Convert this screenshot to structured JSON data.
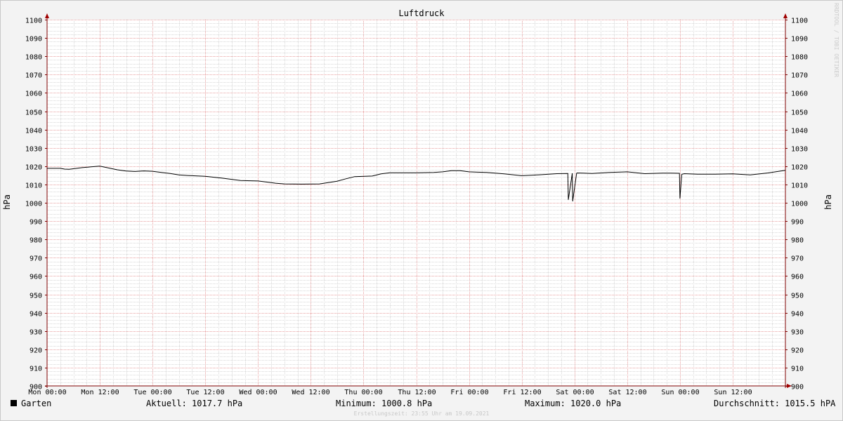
{
  "chart_data": {
    "type": "line",
    "title": "Luftdruck",
    "ylabel": "hPa",
    "ylabel_right": "hPa",
    "ylim": [
      900,
      1100
    ],
    "yticks": [
      "900",
      "910",
      "920",
      "930",
      "940",
      "950",
      "960",
      "970",
      "980",
      "990",
      "1000",
      "1010",
      "1020",
      "1030",
      "1040",
      "1050",
      "1060",
      "1070",
      "1080",
      "1090",
      "1100"
    ],
    "xlim": [
      0,
      168
    ],
    "xtick_labels": [
      "Mon 00:00",
      "Mon 12:00",
      "Tue 00:00",
      "Tue 12:00",
      "Wed 00:00",
      "Wed 12:00",
      "Thu 00:00",
      "Thu 12:00",
      "Fri 00:00",
      "Fri 12:00",
      "Sat 00:00",
      "Sat 12:00",
      "Sun 00:00",
      "Sun 12:00"
    ],
    "grid": true,
    "colors": {
      "line": "#000000",
      "grid_major": "#e8a0a0",
      "grid_minor": "#d8d8d8",
      "axis": "#800000",
      "background": "#ffffff"
    },
    "series": [
      {
        "name": "Garten",
        "x": [
          0,
          3,
          4,
          5,
          6,
          8,
          10,
          12,
          14,
          16,
          18,
          20,
          22,
          24,
          26,
          28,
          30,
          32,
          36,
          40,
          44,
          48,
          52,
          54,
          58,
          62,
          66,
          68,
          70,
          74,
          76,
          78,
          80,
          84,
          88,
          90,
          92,
          94,
          96,
          98,
          100,
          104,
          108,
          112,
          116,
          118.5,
          118.6,
          119.5,
          119.6,
          120.5,
          120.6,
          122,
          124,
          128,
          132,
          136,
          140,
          142,
          143.9,
          144,
          144.4,
          144.5,
          145,
          148,
          152,
          156,
          160,
          164,
          168
        ],
        "y": [
          1018.8,
          1018.8,
          1018.4,
          1018.3,
          1018.6,
          1019.2,
          1019.6,
          1020.0,
          1019.0,
          1018.0,
          1017.3,
          1017.1,
          1017.4,
          1017.2,
          1016.6,
          1016.0,
          1015.2,
          1014.9,
          1014.5,
          1013.4,
          1012.2,
          1011.9,
          1010.7,
          1010.3,
          1010.2,
          1010.3,
          1011.8,
          1013.1,
          1014.3,
          1014.6,
          1015.8,
          1016.4,
          1016.4,
          1016.4,
          1016.6,
          1016.9,
          1017.5,
          1017.5,
          1016.9,
          1016.7,
          1016.6,
          1015.8,
          1014.8,
          1015.3,
          1015.9,
          1016.0,
          1001.6,
          1016.1,
          1000.8,
          1016.1,
          1016.3,
          1016.2,
          1016.0,
          1016.6,
          1016.9,
          1015.9,
          1016.2,
          1016.2,
          1016.1,
          1002.3,
          1015.4,
          1015.6,
          1015.9,
          1015.6,
          1015.6,
          1015.8,
          1015.2,
          1016.3,
          1017.7
        ]
      }
    ]
  },
  "legend": {
    "series_name": "Garten",
    "current": "Aktuell: 1017.7 hPa",
    "minimum": "Minimum: 1000.8 hPa",
    "maximum": "Maximum: 1020.0 hPa",
    "average": "Durchschnitt: 1015.5 hPA"
  },
  "watermark": "RRDTOOL / TOBI OETIKER",
  "footer": "Erstellungszeit: 23:55 Uhr am 19.09.2021"
}
